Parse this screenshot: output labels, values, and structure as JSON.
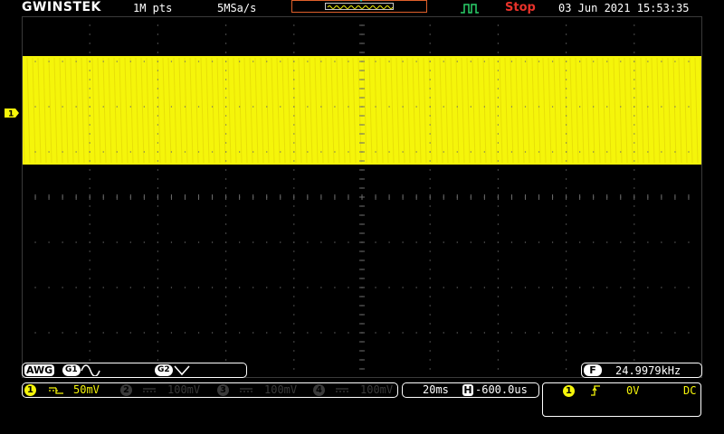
{
  "header": {
    "brand": "GWINSTEK",
    "record_length": "1M pts",
    "sample_rate": "5MSa/s",
    "run_state": "Stop",
    "date": "03 Jun 2021",
    "time": "15:53:35"
  },
  "display": {
    "waveform_color": "#f5f50a",
    "background_color": "#000000",
    "grid_color": "#6a6a6a",
    "ch1_marker_label": "1"
  },
  "generator": {
    "label": "AWG",
    "g1_label": "G1",
    "g1_waveform_icon": "sine-icon",
    "g2_label": "G2",
    "g2_waveform_icon": "triangle-icon"
  },
  "frequency": {
    "label": "F",
    "value": "24.9979kHz"
  },
  "channels": [
    {
      "num": "1",
      "state": "on",
      "coupling_icon": "dc-coupling-icon",
      "scale": "50mV"
    },
    {
      "num": "2",
      "state": "off",
      "coupling_icon": "dc-coupling-icon",
      "scale": "100mV"
    },
    {
      "num": "3",
      "state": "off",
      "coupling_icon": "dc-coupling-icon",
      "scale": "100mV"
    },
    {
      "num": "4",
      "state": "off",
      "coupling_icon": "dc-coupling-icon",
      "scale": "100mV"
    }
  ],
  "timebase": {
    "scale": "20ms",
    "h_label": "H",
    "position": "-600.0us"
  },
  "trigger": {
    "source": "1",
    "slope_icon": "rising-edge-icon",
    "level": "0V",
    "coupling": "DC"
  }
}
